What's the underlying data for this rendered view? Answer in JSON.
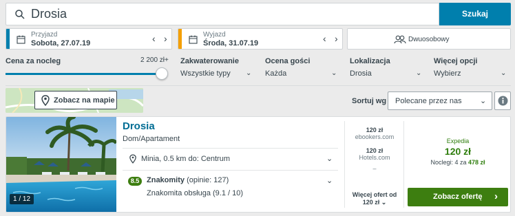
{
  "search": {
    "query": "Drosia",
    "button_label": "Szukaj"
  },
  "dates": {
    "checkin": {
      "label": "Przyjazd",
      "value": "Sobota, 27.07.19",
      "accent": "#007fad"
    },
    "checkout": {
      "label": "Wyjazd",
      "value": "Środa, 31.07.19",
      "accent": "#f49f00"
    }
  },
  "room": {
    "label": "Dwuosobowy"
  },
  "filters": {
    "price": {
      "label": "Cena za nocleg",
      "value": "2 200 zł+",
      "fraction": 1.0
    },
    "items": [
      {
        "label": "Zakwaterowanie",
        "value": "Wszystkie typy"
      },
      {
        "label": "Ocena gości",
        "value": "Każda"
      },
      {
        "label": "Lokalizacja",
        "value": "Drosia"
      },
      {
        "label": "Więcej opcji",
        "value": "Wybierz"
      }
    ]
  },
  "map_button": "Zobacz na mapie",
  "sort": {
    "label": "Sortuj wg",
    "value": "Polecane przez nas"
  },
  "hotel": {
    "name": "Drosia",
    "type": "Dom/Apartament",
    "location": "Minia, 0.5 km do: Centrum",
    "rating": "8.5",
    "rating_label": "Znakomity",
    "reviews": "(opinie: 127)",
    "service": "Znakomita obsługa (9.1 / 10)",
    "photo_counter": "1 / 12",
    "offers": [
      {
        "price": "120 zł",
        "site": "ebookers.com"
      },
      {
        "price": "120 zł",
        "site": "Hotels.com"
      }
    ],
    "offers_dash": "–",
    "more_offers_line1": "Więcej ofert od",
    "more_offers_line2": "120 zł",
    "deal_site": "Expedia",
    "deal_price": "120 zł",
    "deal_nights_prefix": "Noclegi: 4 za",
    "deal_total": "478 zł",
    "cta_label": "Zobacz ofertę",
    "colors": {
      "link": "#006d94",
      "green": "#3d7e10",
      "deal_green": "#2e7d0c"
    }
  }
}
